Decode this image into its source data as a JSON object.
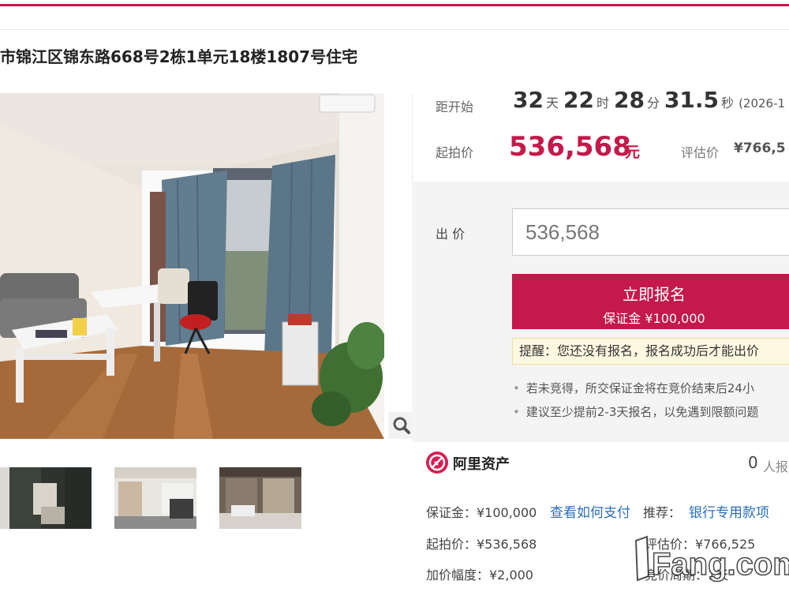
{
  "title": "市锦江区锦东路668号2栋1单元18楼1807号住宅",
  "countdown": {
    "label": "距开始",
    "days": "32",
    "days_unit": "天",
    "hours": "22",
    "hours_unit": "时",
    "minutes": "28",
    "minutes_unit": "分",
    "seconds": "31.5",
    "seconds_unit": "秒",
    "start_time": "(2026-1"
  },
  "start_price": {
    "label": "起拍价",
    "value": "536,568",
    "unit": "元"
  },
  "evaluation": {
    "label": "评估价",
    "value": "¥766,5"
  },
  "bid": {
    "label": "出 价",
    "value": "536,568"
  },
  "signup_button": {
    "label": "立即报名",
    "deposit": "保证金 ¥100,000"
  },
  "reminder": "提醒：您还没有报名，报名成功后才能出价",
  "notes": [
    "若未竞得，所交保证金将在竞价结束后24小",
    "建议至少提前2-3天报名，以免遇到限额问题"
  ],
  "platform": {
    "name": "阿里资产",
    "count": "0",
    "count_label": "人报"
  },
  "details": {
    "deposit": "保证金：¥100,000",
    "how_to_pay": "查看如何支付",
    "recommend_label": "推荐：",
    "recommend_link": "银行专用款项",
    "start_price": "起拍价：¥536,568",
    "evaluation": "评估价：¥766,525",
    "increment": "加价幅度：¥2,000",
    "cycle": "竞价周期：1天"
  },
  "watermark": "Fang.com",
  "colors": {
    "accent": "#c4194a",
    "link": "#2a6fb8",
    "reminder_bg": "#fff8e1"
  }
}
